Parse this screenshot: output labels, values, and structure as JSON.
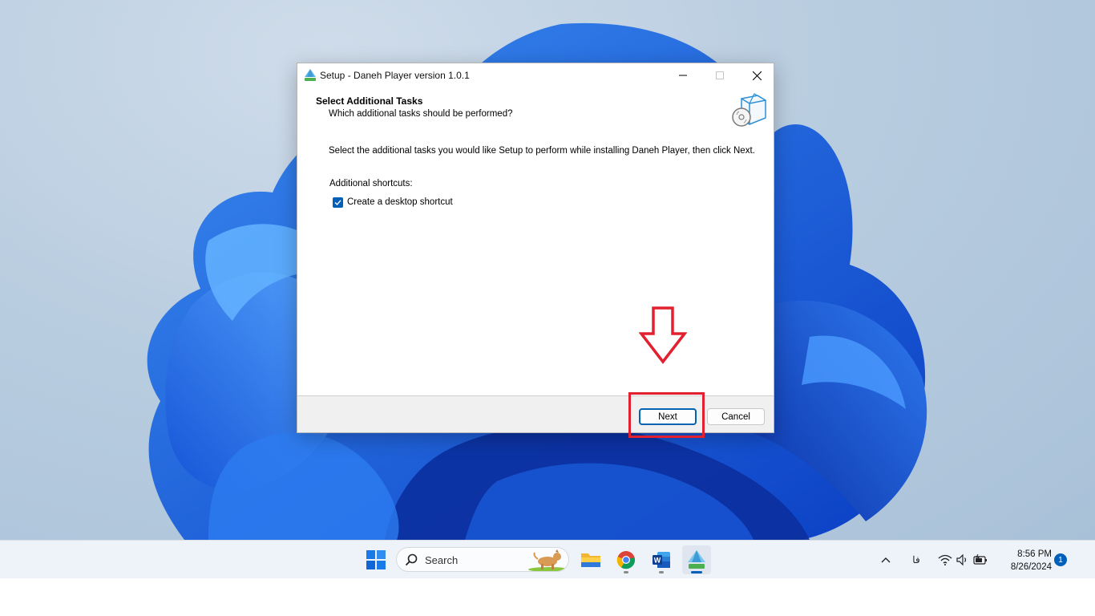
{
  "window": {
    "title": "Setup - Daneh Player version 1.0.1",
    "page_title": "Select Additional Tasks",
    "page_subtitle": "Which additional tasks should be performed?",
    "instruction": "Select the additional tasks you would like Setup to perform while installing Daneh Player, then click Next.",
    "group_label": "Additional shortcuts:",
    "tasks": [
      {
        "label": "Create a desktop shortcut",
        "checked": true
      }
    ],
    "buttons": {
      "next": "Next",
      "cancel": "Cancel"
    }
  },
  "annotation": {
    "color": "#e3202f"
  },
  "taskbar": {
    "search_placeholder": "Search",
    "apps": [
      "start-icon",
      "file-explorer-icon",
      "chrome-icon",
      "word-icon",
      "daneh-player-icon"
    ],
    "language": "فا",
    "time": "8:56 PM",
    "date": "8/26/2024",
    "notification_count": "1"
  },
  "colors": {
    "accent": "#005fb8",
    "highlight": "#e3202f"
  }
}
